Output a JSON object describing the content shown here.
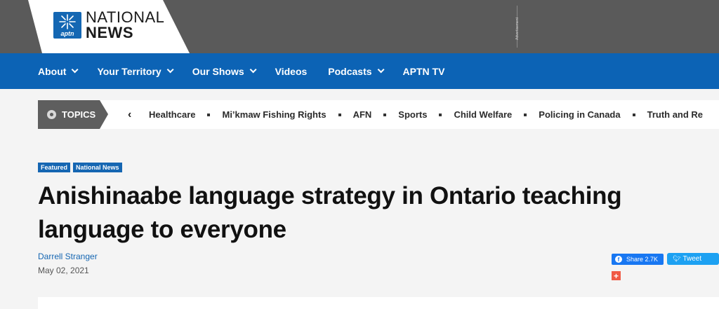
{
  "brand": {
    "logo_badge": "aptn",
    "logo_line1": "NATIONAL",
    "logo_line2": "NEWS",
    "ad_label": "Advertisement"
  },
  "nav": {
    "items": [
      {
        "label": "About",
        "dropdown": true
      },
      {
        "label": "Your Territory",
        "dropdown": true
      },
      {
        "label": "Our Shows",
        "dropdown": true
      },
      {
        "label": "Videos",
        "dropdown": false
      },
      {
        "label": "Podcasts",
        "dropdown": true
      },
      {
        "label": "APTN TV",
        "dropdown": false
      }
    ]
  },
  "topics": {
    "label": "TOPICS",
    "prev_glyph": "‹",
    "items": [
      "Healthcare",
      "Mi’kmaw Fishing Rights",
      "AFN",
      "Sports",
      "Child Welfare",
      "Policing in Canada",
      "Truth and Re"
    ]
  },
  "article": {
    "tags": [
      "Featured",
      "National News"
    ],
    "title": "Anishinaabe language strategy in Ontario teaching language to everyone",
    "author": "Darrell Stranger",
    "date": "May 02, 2021"
  },
  "share": {
    "facebook_label": "Share 2.7K",
    "twitter_label": "Tweet",
    "more_label": "+"
  },
  "colors": {
    "nav_blue": "#0c63b5",
    "header_gray": "#5a5a5a",
    "tag_blue": "#1566b2"
  }
}
